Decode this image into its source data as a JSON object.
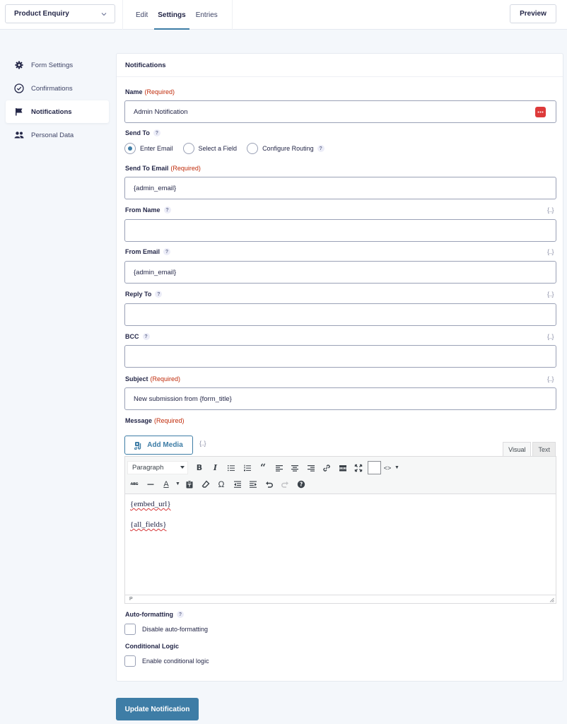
{
  "topbar": {
    "form_select": "Product Enquiry",
    "tabs": [
      {
        "label": "Edit",
        "active": false
      },
      {
        "label": "Settings",
        "active": true
      },
      {
        "label": "Entries",
        "active": false
      }
    ],
    "preview_label": "Preview"
  },
  "sidebar": {
    "items": [
      {
        "label": "Form Settings",
        "icon": "gear-icon",
        "active": false
      },
      {
        "label": "Confirmations",
        "icon": "check-circle-icon",
        "active": false
      },
      {
        "label": "Notifications",
        "icon": "flag-icon",
        "active": true
      },
      {
        "label": "Personal Data",
        "icon": "users-icon",
        "active": false
      }
    ]
  },
  "panel": {
    "title": "Notifications",
    "required_text": "(Required)",
    "help_glyph": "?",
    "merge_tag_glyph": "{..}",
    "name": {
      "label": "Name",
      "value": "Admin Notification"
    },
    "send_to": {
      "label": "Send To",
      "options": [
        {
          "label": "Enter Email",
          "selected": true
        },
        {
          "label": "Select a Field",
          "selected": false
        },
        {
          "label": "Configure Routing",
          "selected": false
        }
      ]
    },
    "send_to_email": {
      "label": "Send To Email",
      "value": "{admin_email}"
    },
    "from_name": {
      "label": "From Name",
      "value": ""
    },
    "from_email": {
      "label": "From Email",
      "value": "{admin_email}"
    },
    "reply_to": {
      "label": "Reply To",
      "value": ""
    },
    "bcc": {
      "label": "BCC",
      "value": ""
    },
    "subject": {
      "label": "Subject",
      "value": "New submission from {form_title}"
    },
    "message": {
      "label": "Message",
      "add_media_label": "Add Media",
      "editor_tabs": [
        {
          "label": "Visual",
          "active": true
        },
        {
          "label": "Text",
          "active": false
        }
      ],
      "format_select": "Paragraph",
      "content_lines": [
        "{embed_url}",
        "{all_fields}"
      ],
      "status_path": "P"
    },
    "auto_formatting": {
      "label": "Auto-formatting",
      "checkbox_label": "Disable auto-formatting",
      "checked": false
    },
    "conditional_logic": {
      "label": "Conditional Logic",
      "checkbox_label": "Enable conditional logic",
      "checked": false
    }
  },
  "update_button": "Update Notification",
  "colors": {
    "accent": "#3e7da6",
    "required": "#c02b0a",
    "merge_icon_red": "#dd3a3a"
  }
}
